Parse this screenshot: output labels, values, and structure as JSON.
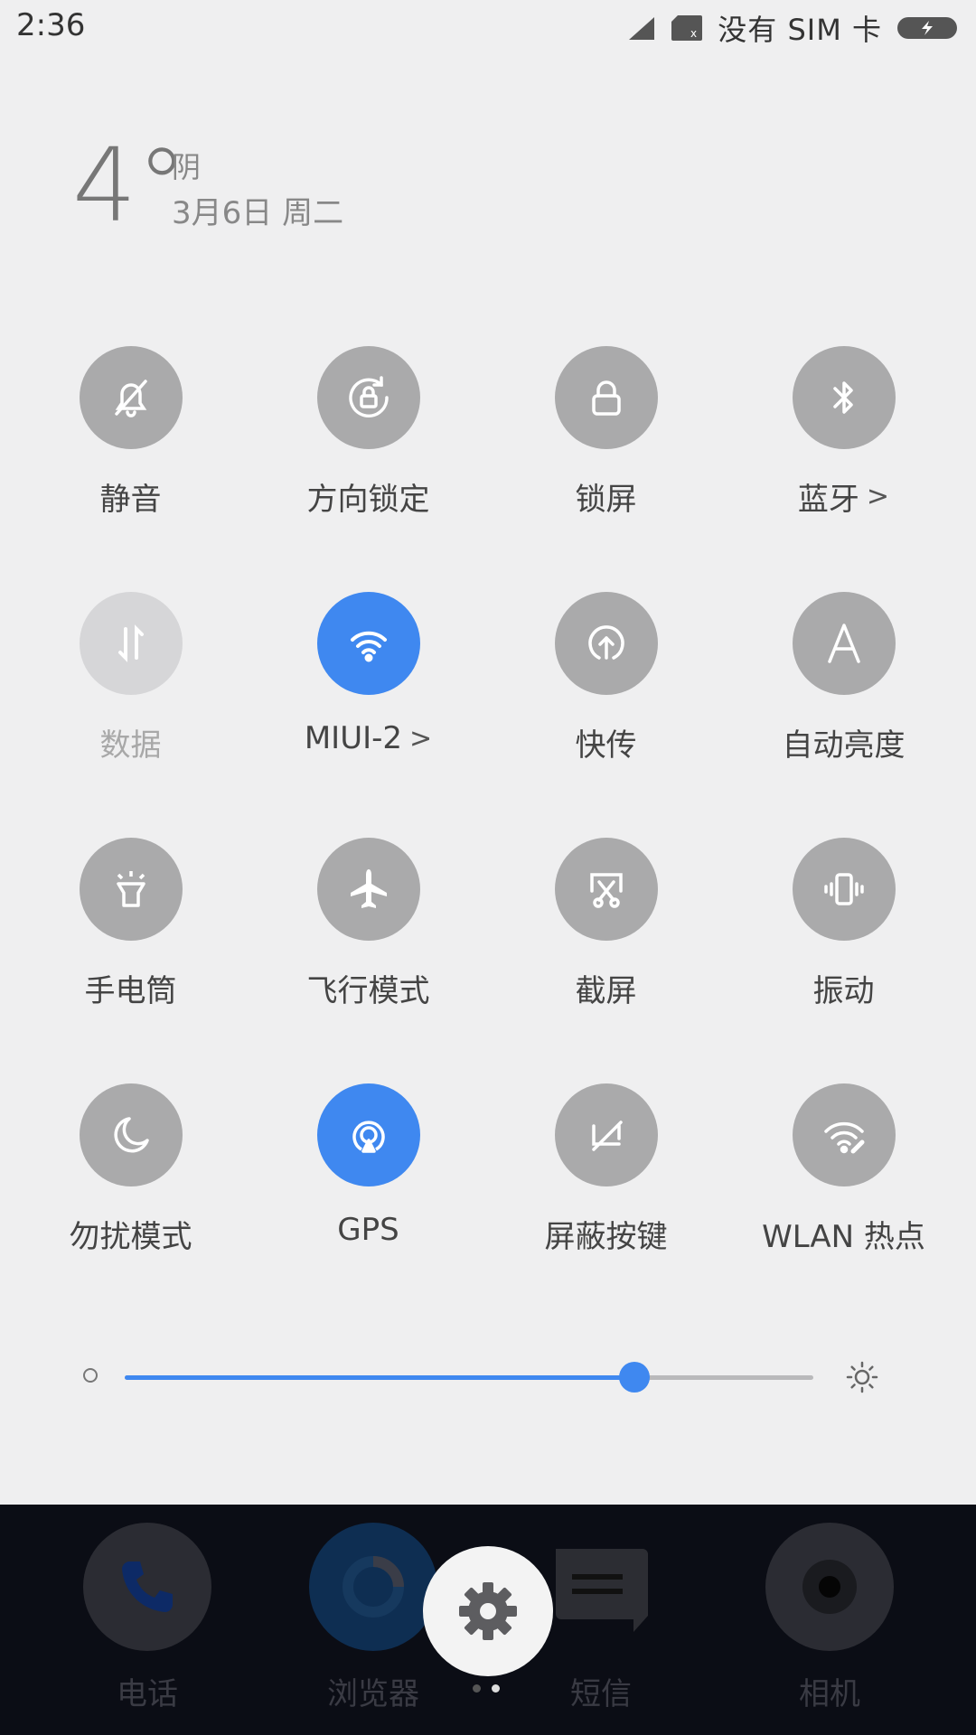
{
  "status_bar": {
    "time": "2:36",
    "carrier": "没有 SIM 卡"
  },
  "weather": {
    "temp": "4°",
    "condition": "阴",
    "date": "3月6日 周二"
  },
  "toggles": [
    {
      "label": "静音",
      "icon": "bell-off-icon",
      "state": "off"
    },
    {
      "label": "方向锁定",
      "icon": "rotation-lock-icon",
      "state": "off"
    },
    {
      "label": "锁屏",
      "icon": "lock-icon",
      "state": "off"
    },
    {
      "label": "蓝牙",
      "icon": "bluetooth-icon",
      "state": "off",
      "chevron": ">"
    },
    {
      "label": "数据",
      "icon": "mobile-data-icon",
      "state": "disabled"
    },
    {
      "label": "MIUI-2",
      "icon": "wifi-icon",
      "state": "on",
      "chevron": ">"
    },
    {
      "label": "快传",
      "icon": "share-upload-icon",
      "state": "off"
    },
    {
      "label": "自动亮度",
      "icon": "auto-brightness-icon",
      "state": "off"
    },
    {
      "label": "手电筒",
      "icon": "flashlight-icon",
      "state": "off"
    },
    {
      "label": "飞行模式",
      "icon": "airplane-icon",
      "state": "off"
    },
    {
      "label": "截屏",
      "icon": "screenshot-icon",
      "state": "off"
    },
    {
      "label": "振动",
      "icon": "vibrate-icon",
      "state": "off"
    },
    {
      "label": "勿扰模式",
      "icon": "moon-icon",
      "state": "off"
    },
    {
      "label": "GPS",
      "icon": "gps-icon",
      "state": "on"
    },
    {
      "label": "屏蔽按键",
      "icon": "block-keys-icon",
      "state": "off"
    },
    {
      "label": "WLAN 热点",
      "icon": "hotspot-icon",
      "state": "off"
    }
  ],
  "brightness": {
    "level": 0.74
  },
  "dock": {
    "apps": [
      {
        "label": "电话",
        "icon": "phone-icon"
      },
      {
        "label": "浏览器",
        "icon": "browser-icon"
      },
      {
        "label": "短信",
        "icon": "message-icon"
      },
      {
        "label": "相机",
        "icon": "camera-icon"
      }
    ],
    "settings_icon": "gear-icon"
  },
  "colors": {
    "accent": "#3f88f0",
    "toggle_off": "#aaaaab",
    "background": "#efeff0"
  }
}
